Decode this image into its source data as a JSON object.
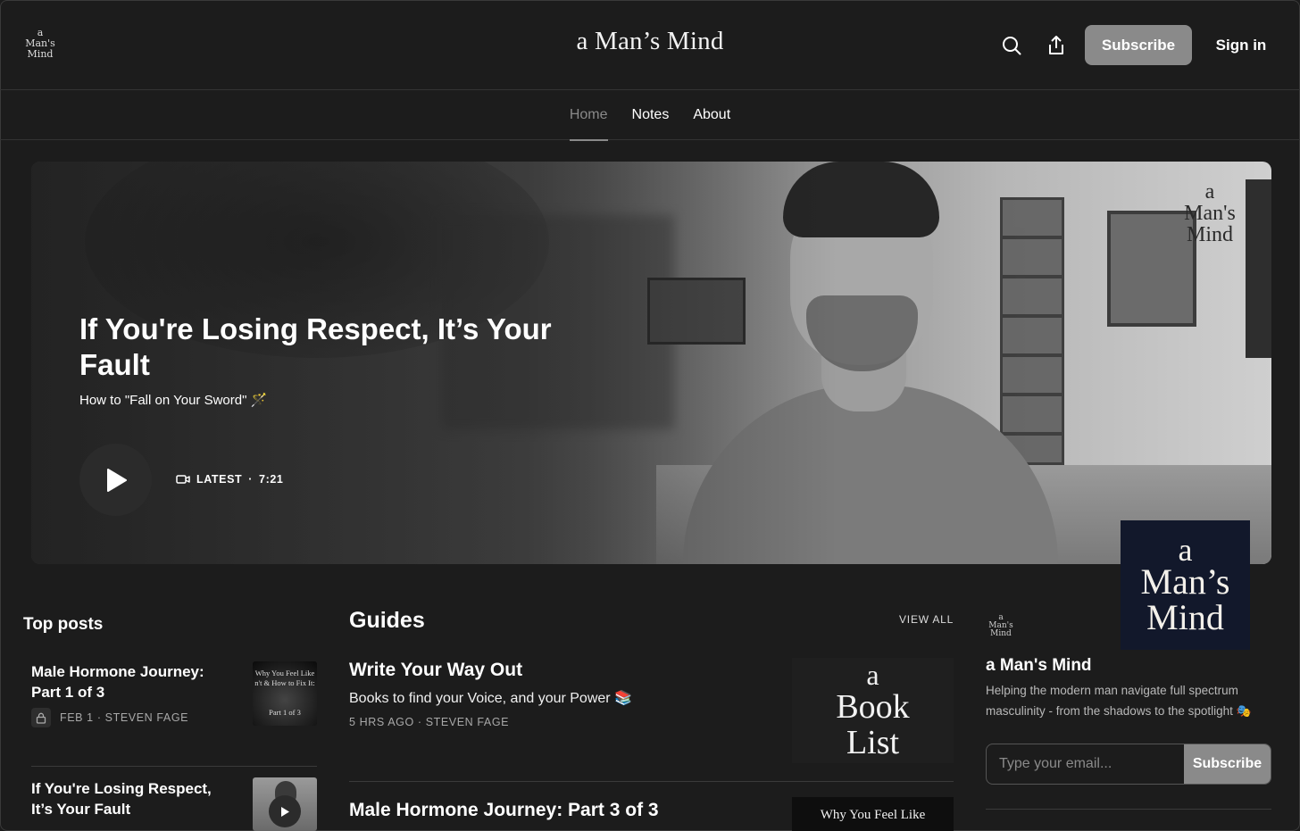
{
  "header": {
    "logo_line1": "a",
    "logo_line2": "Man's",
    "logo_line3": "Mind",
    "site_title": "a Man’s Mind",
    "subscribe_label": "Subscribe",
    "signin_label": "Sign in"
  },
  "nav": {
    "items": [
      {
        "label": "Home",
        "active": true
      },
      {
        "label": "Notes",
        "active": false
      },
      {
        "label": "About",
        "active": false
      }
    ]
  },
  "hero": {
    "title": "If You're Losing Respect, It’s Your Fault",
    "subtitle": "How to \"Fall on Your Sword\" 🪄",
    "badge": "LATEST",
    "duration": "7:21",
    "watermark_line1": "a",
    "watermark_line2": "Man's",
    "watermark_line3": "Mind"
  },
  "brand_card": {
    "line1": "a",
    "line2": "Man’s",
    "line3": "Mind",
    "bg_color": "#12182b"
  },
  "top_posts": {
    "heading": "Top posts",
    "items": [
      {
        "title": "Male Hormone Journey: Part 1 of 3",
        "date": "FEB 1",
        "author": "STEVEN FAGE",
        "locked": true,
        "thumb_text_1": "Why You Feel Like",
        "thumb_text_2": "n't & How to Fix It:",
        "thumb_text_3": "Part 1 of 3"
      },
      {
        "title": "If You're Losing Respect, It’s Your Fault",
        "date": "",
        "author": "",
        "locked": false
      }
    ]
  },
  "guides": {
    "heading": "Guides",
    "view_all": "VIEW ALL",
    "items": [
      {
        "title": "Write Your Way Out",
        "subtitle": "Books to find your Voice, and your Power 📚",
        "meta": "5 HRS AGO · STEVEN FAGE",
        "thumb_line1": "a",
        "thumb_line2": "Book",
        "thumb_line3": "List"
      },
      {
        "title": "Male Hormone Journey: Part 3 of 3",
        "thumb_text": "Why You Feel Like"
      }
    ]
  },
  "about": {
    "logo_line1": "a",
    "logo_line2": "Man's",
    "logo_line3": "Mind",
    "title": "a Man's Mind",
    "description": "Helping the modern man navigate full spectrum masculinity - from the shadows to the spotlight 🎭",
    "email_placeholder": "Type your email...",
    "subscribe_label": "Subscribe"
  },
  "icons": {
    "search": "search-icon",
    "share": "share-icon",
    "play": "play-icon",
    "video": "video-camera-icon",
    "lock": "lock-icon"
  },
  "colors": {
    "background": "#1c1c1c",
    "button_gray": "#8a8a8a",
    "text_muted": "#a8a8a8"
  }
}
